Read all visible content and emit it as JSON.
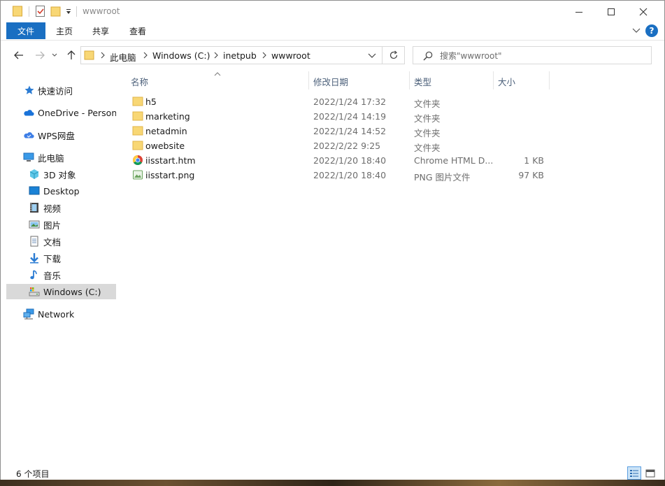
{
  "window": {
    "title": "wwwroot"
  },
  "ribbon": {
    "tabs": [
      {
        "label": "文件"
      },
      {
        "label": "主页"
      },
      {
        "label": "共享"
      },
      {
        "label": "查看"
      }
    ],
    "help_label": "?"
  },
  "address": {
    "crumbs": [
      "此电脑",
      "Windows (C:)",
      "inetpub",
      "wwwroot"
    ]
  },
  "search": {
    "placeholder": "搜索\"wwwroot\""
  },
  "sidebar": {
    "items": [
      {
        "label": "快速访问",
        "icon": "star-icon"
      },
      {
        "label": "OneDrive - Persona",
        "icon": "onedrive-cloud-icon"
      },
      {
        "label": "WPS网盘",
        "icon": "wps-cloud-icon"
      },
      {
        "label": "此电脑",
        "icon": "computer-icon"
      },
      {
        "label": "3D 对象",
        "icon": "3d-objects-icon"
      },
      {
        "label": "Desktop",
        "icon": "desktop-icon"
      },
      {
        "label": "视频",
        "icon": "video-icon"
      },
      {
        "label": "图片",
        "icon": "pictures-icon"
      },
      {
        "label": "文档",
        "icon": "documents-icon"
      },
      {
        "label": "下载",
        "icon": "download-icon"
      },
      {
        "label": "音乐",
        "icon": "music-icon"
      },
      {
        "label": "Windows (C:)",
        "icon": "drive-icon"
      },
      {
        "label": "Network",
        "icon": "network-icon"
      }
    ]
  },
  "columns": {
    "name": "名称",
    "date": "修改日期",
    "type": "类型",
    "size": "大小"
  },
  "files": [
    {
      "name": "h5",
      "date": "2022/1/24 17:32",
      "type": "文件夹",
      "size": "",
      "icon": "folder-icon"
    },
    {
      "name": "marketing",
      "date": "2022/1/24 14:19",
      "type": "文件夹",
      "size": "",
      "icon": "folder-icon"
    },
    {
      "name": "netadmin",
      "date": "2022/1/24 14:52",
      "type": "文件夹",
      "size": "",
      "icon": "folder-icon"
    },
    {
      "name": "owebsite",
      "date": "2022/2/22 9:25",
      "type": "文件夹",
      "size": "",
      "icon": "folder-icon"
    },
    {
      "name": "iisstart.htm",
      "date": "2022/1/20 18:40",
      "type": "Chrome HTML D...",
      "size": "1 KB",
      "icon": "chrome-icon"
    },
    {
      "name": "iisstart.png",
      "date": "2022/1/20 18:40",
      "type": "PNG 图片文件",
      "size": "97 KB",
      "icon": "png-file-icon"
    }
  ],
  "status": {
    "count_text": "6 个项目"
  },
  "colors": {
    "accent": "#1a6fc2",
    "folder": "#f8d775",
    "selection": "#d9d9d9"
  }
}
